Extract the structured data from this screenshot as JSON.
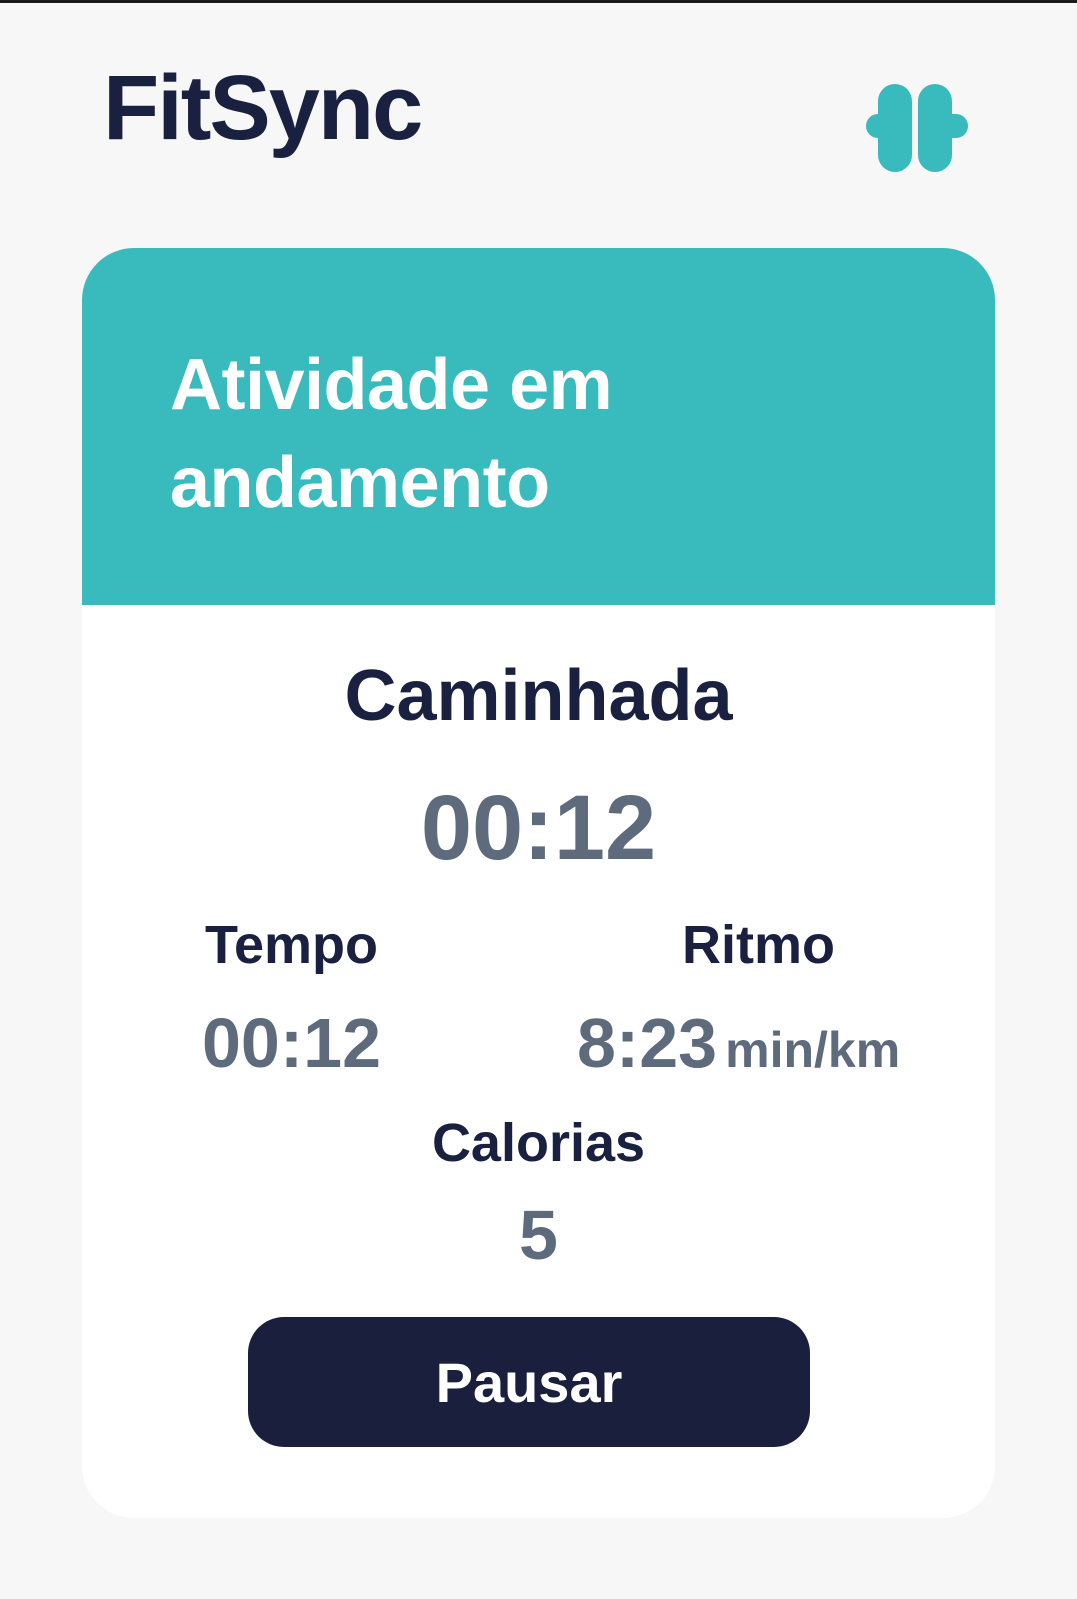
{
  "app": {
    "title": "FitSync",
    "icon": "dumbbell-icon",
    "accent_color": "#39babd",
    "title_color": "#1a2140"
  },
  "card": {
    "header_title": "Atividade em andamento",
    "activity_name": "Caminhada",
    "timer": "00:12",
    "stats": {
      "tempo_label": "Tempo",
      "tempo_value": "00:12",
      "ritmo_label": "Ritmo",
      "ritmo_value": "8:23",
      "ritmo_unit": "min/km",
      "calorias_label": "Calorias",
      "calorias_value": "5"
    },
    "pause_button_label": "Pausar",
    "button_color": "#1a1f3d"
  }
}
